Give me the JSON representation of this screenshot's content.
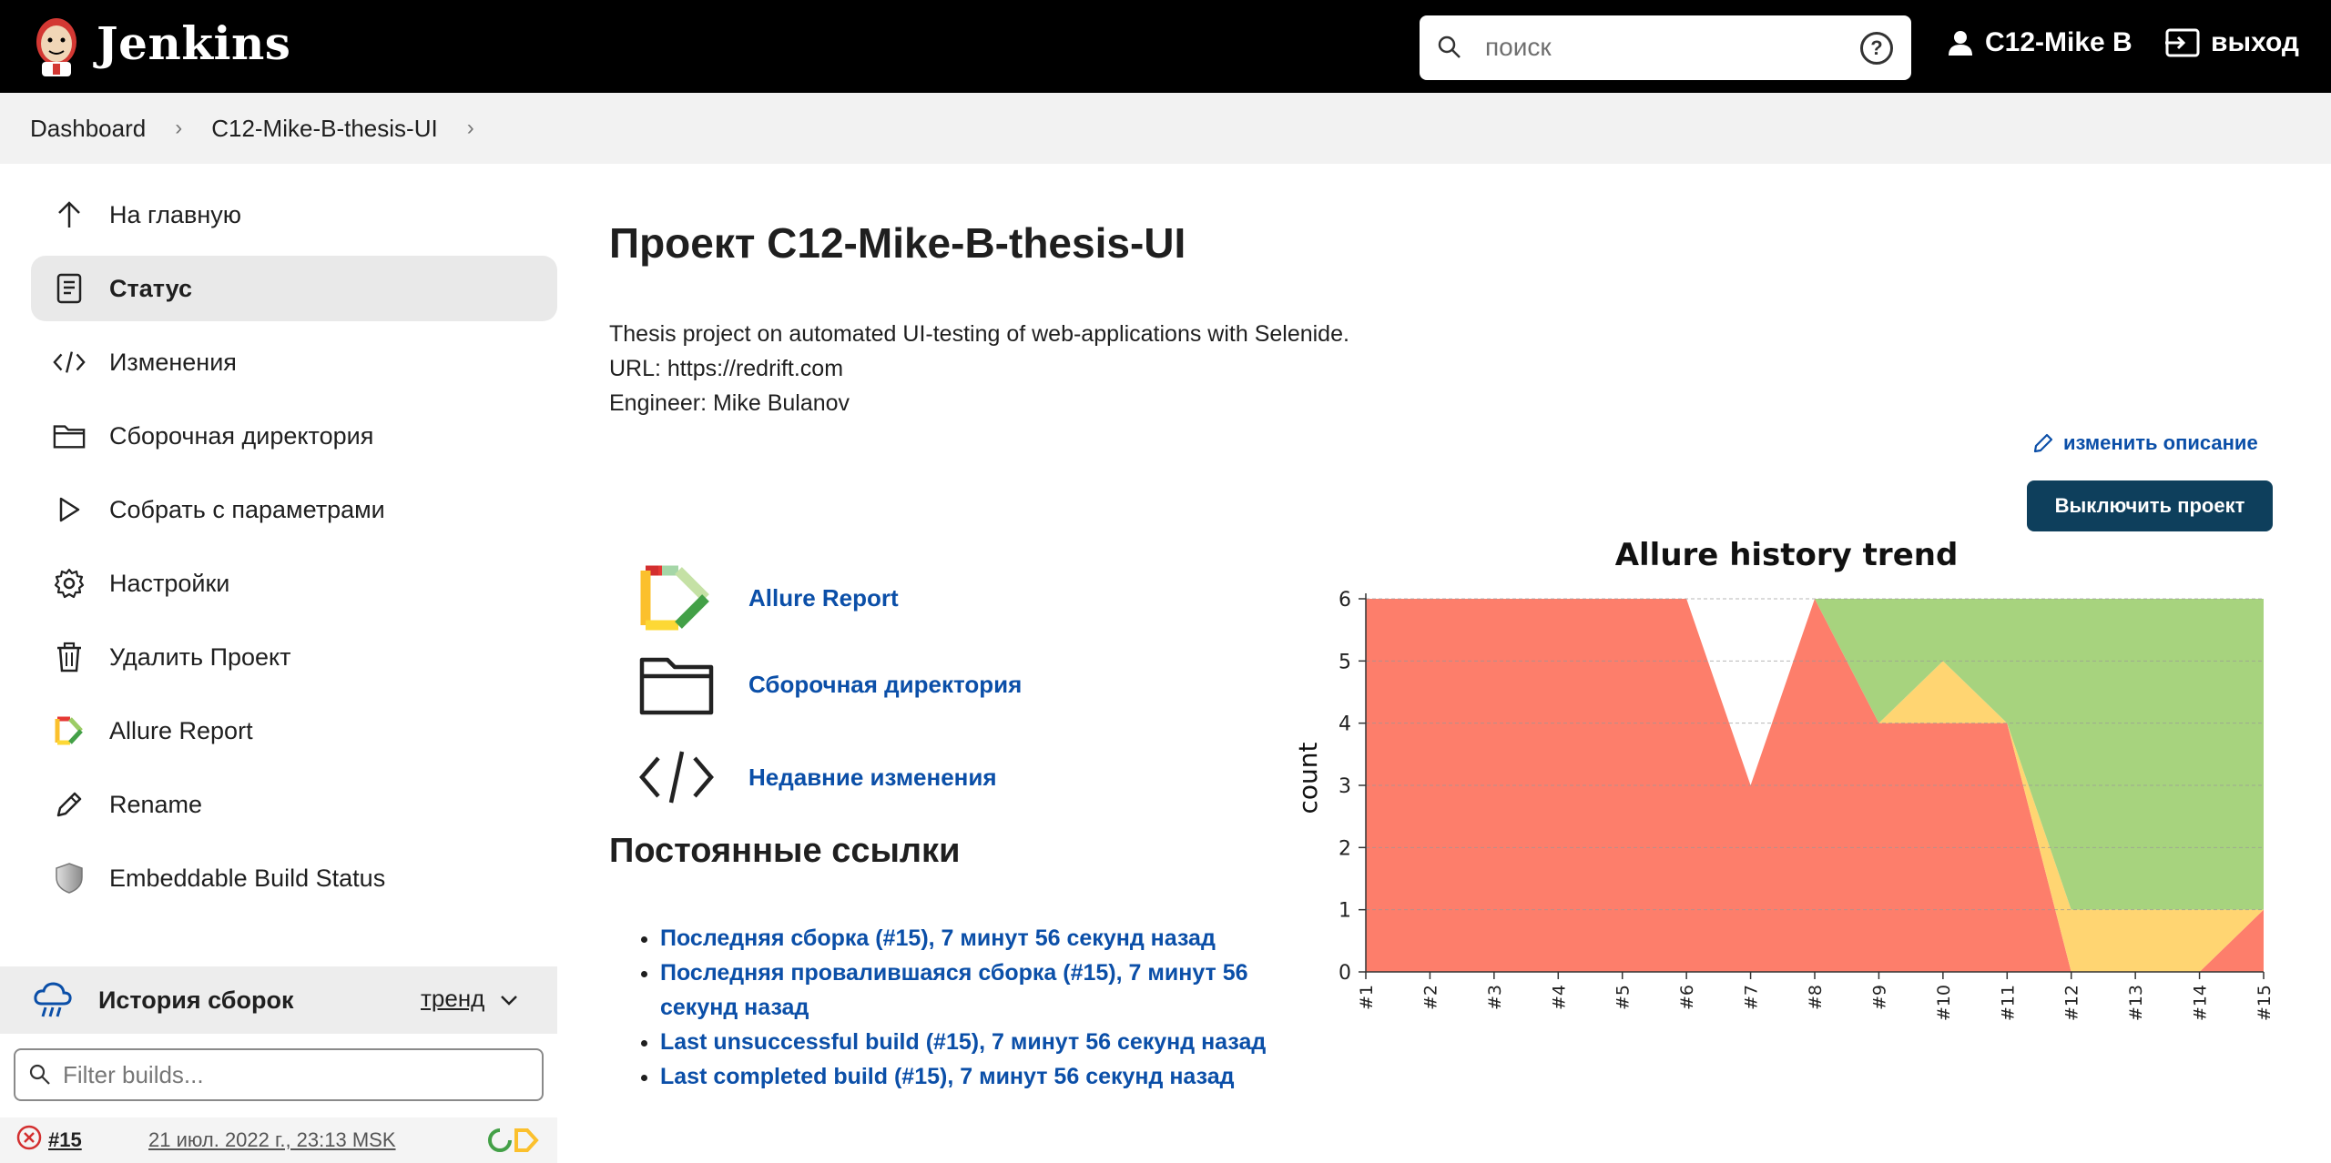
{
  "header": {
    "brand": "Jenkins",
    "search_placeholder": "поиск",
    "help_label": "?",
    "user_name": "C12-Mike B",
    "logout_label": "выход"
  },
  "breadcrumbs": [
    "Dashboard",
    "C12-Mike-B-thesis-UI"
  ],
  "sidebar": {
    "items": [
      {
        "label": "На главную",
        "icon": "arrow-up-icon"
      },
      {
        "label": "Статус",
        "icon": "document-icon"
      },
      {
        "label": "Изменения",
        "icon": "code-icon"
      },
      {
        "label": "Сборочная директория",
        "icon": "folder-icon"
      },
      {
        "label": "Собрать с параметрами",
        "icon": "play-icon"
      },
      {
        "label": "Настройки",
        "icon": "gear-icon"
      },
      {
        "label": "Удалить Проект",
        "icon": "trash-icon"
      },
      {
        "label": "Allure Report",
        "icon": "allure-icon"
      },
      {
        "label": "Rename",
        "icon": "pencil-icon"
      },
      {
        "label": "Embeddable Build Status",
        "icon": "shield-icon"
      }
    ],
    "history": {
      "title": "История сборок",
      "trend_label": "тренд"
    },
    "filter_placeholder": "Filter builds...",
    "builds": [
      {
        "number": "#15",
        "date": "21 июл. 2022 г., 23:13 MSK",
        "status": "failed"
      }
    ]
  },
  "main": {
    "title": "Проект C12-Mike-B-thesis-UI",
    "description_lines": [
      "Thesis project on automated UI-testing of web-applications with Selenide.",
      "URL: https://redrift.com",
      "Engineer: Mike Bulanov"
    ],
    "edit_description_label": "изменить описание",
    "disable_button_label": "Выключить проект",
    "actions": [
      {
        "label": "Allure Report",
        "icon": "allure-icon"
      },
      {
        "label": "Сборочная директория",
        "icon": "folder-icon"
      },
      {
        "label": "Недавние изменения",
        "icon": "code-icon"
      }
    ],
    "permalinks_title": "Постоянные ссылки",
    "permalinks": [
      "Последняя сборка (#15), 7 минут 56 секунд назад",
      "Последняя провалившаяся сборка (#15), 7 минут 56 секунд назад",
      "Last unsuccessful build (#15), 7 минут 56 секунд назад",
      "Last completed build (#15), 7 минут 56 секунд назад"
    ]
  },
  "colors": {
    "failed": "#fd7e6b",
    "broken": "#ffd572",
    "passed": "#a7d37e",
    "link": "#0b4fa8",
    "primary_button": "#0e3f5c"
  },
  "chart_data": {
    "type": "area",
    "title": "Allure history trend",
    "ylabel": "count",
    "xlabel": "",
    "x": [
      "#1",
      "#2",
      "#3",
      "#4",
      "#5",
      "#6",
      "#7",
      "#8",
      "#9",
      "#10",
      "#11",
      "#12",
      "#13",
      "#14",
      "#15"
    ],
    "ylim": [
      0,
      6
    ],
    "yticks": [
      0,
      1,
      2,
      3,
      4,
      5,
      6
    ],
    "stacked": true,
    "series": [
      {
        "values": [
          6,
          6,
          6,
          6,
          6,
          6,
          3,
          6,
          4,
          4,
          4,
          0,
          0,
          0,
          1
        ],
        "color": "#fd7e6b"
      },
      {
        "values": [
          0,
          0,
          0,
          0,
          0,
          0,
          0,
          0,
          0,
          1,
          0,
          1,
          1,
          1,
          0
        ],
        "color": "#ffd572"
      },
      {
        "values": [
          0,
          0,
          0,
          0,
          0,
          0,
          0,
          0,
          2,
          1,
          2,
          5,
          5,
          5,
          5
        ],
        "color": "#a7d37e"
      }
    ],
    "grid": true
  }
}
